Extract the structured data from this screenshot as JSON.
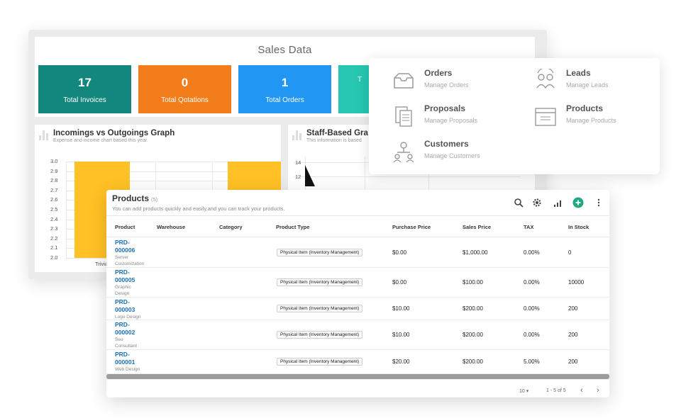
{
  "dashboard": {
    "sales_title": "Sales Data",
    "tiles": [
      {
        "value": "17",
        "label": "Total Invoices",
        "color": "#13877d"
      },
      {
        "value": "0",
        "label": "Total Qotations",
        "color": "#f27d1a"
      },
      {
        "value": "1",
        "label": "Total Orders",
        "color": "#2196f3"
      },
      {
        "value": "",
        "label": "T",
        "color": "#26c6b0"
      }
    ],
    "panel1": {
      "title": "Incomings vs Outgoings Graph",
      "subtitle": "Expense and income chart based this year.",
      "chart_data": {
        "type": "bar",
        "categories": [
          "Trivia"
        ],
        "series": [
          {
            "values": [
              3.0
            ]
          },
          {
            "values": [
              3.0
            ]
          }
        ],
        "ylim": [
          2.0,
          3.0
        ],
        "yticks": [
          "3.0",
          "2.9",
          "2.8",
          "2.7",
          "2.6",
          "2.5",
          "2.4",
          "2.3",
          "2.2",
          "2.1",
          "2.0"
        ],
        "grid": true
      }
    },
    "panel2": {
      "title": "Staff-Based Gra",
      "subtitle": "This information is based",
      "yticks": [
        "14",
        "12"
      ]
    }
  },
  "quick": {
    "items": [
      {
        "title": "Orders",
        "sub": "Manage Orders",
        "icon": "inbox-icon"
      },
      {
        "title": "Leads",
        "sub": "Manage Leads",
        "icon": "leads-icon"
      },
      {
        "title": "Proposals",
        "sub": "Manage Proposals",
        "icon": "documents-icon"
      },
      {
        "title": "Products",
        "sub": "Manage Products",
        "icon": "box-icon"
      },
      {
        "title": "Customers",
        "sub": "Manage Customers",
        "icon": "customers-icon"
      }
    ]
  },
  "products": {
    "title": "Products",
    "count": "(5)",
    "subtitle": "You can add products quickly and easily,and you can track your products.",
    "toolbar_icons": [
      "search-icon",
      "gear-icon",
      "signal-icon",
      "add-icon",
      "more-icon"
    ],
    "add_color": "#1fa883",
    "columns": [
      "Product",
      "Warehouse",
      "Category",
      "Product Type",
      "Purchase Price",
      "Sales Price",
      "TAX",
      "In Stock"
    ],
    "rows": [
      {
        "id": "PRD-\n000006",
        "name": "Server\nCustomization",
        "type": "Physical Item (Inventory Management)",
        "purchase": "$0.00",
        "sales": "$1,000.00",
        "tax": "0.00%",
        "stock": "0"
      },
      {
        "id": "PRD-\n000005",
        "name": "Graphic\nDesign",
        "type": "Physical Item (Inventory Management)",
        "purchase": "$0.00",
        "sales": "$100.00",
        "tax": "0.00%",
        "stock": "10000"
      },
      {
        "id": "PRD-\n000003",
        "name": "Logo Design",
        "type": "Physical Item (Inventory Management)",
        "purchase": "$10.00",
        "sales": "$200.00",
        "tax": "0.00%",
        "stock": "200"
      },
      {
        "id": "PRD-\n000002",
        "name": "Seo\nConsultant",
        "type": "Physical Item (Inventory Management)",
        "purchase": "$10.00",
        "sales": "$200.00",
        "tax": "0.00%",
        "stock": "200"
      },
      {
        "id": "PRD-\n000001",
        "name": "Web Design",
        "type": "Physical Item (Inventory Management)",
        "purchase": "$20.00",
        "sales": "$200.00",
        "tax": "5.00%",
        "stock": "200"
      }
    ],
    "page_size": "10",
    "range": "1 - 5 of 5"
  }
}
